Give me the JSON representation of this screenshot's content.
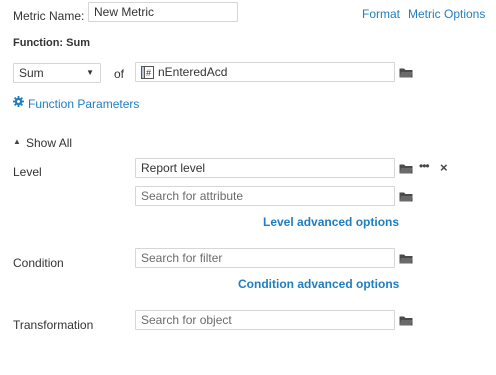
{
  "header": {
    "metric_name_label": "Metric Name:",
    "metric_name_value": "New Metric",
    "format_link": "Format",
    "metric_options_link": "Metric Options"
  },
  "function": {
    "title": "Function: Sum",
    "selected": "Sum",
    "of_label": "of",
    "object_value": "nEnteredAcd",
    "parameters_link": "Function Parameters"
  },
  "show_all": {
    "label": "Show All"
  },
  "level": {
    "label": "Level",
    "value": "Report level",
    "search_placeholder": "Search for attribute",
    "advanced_link": "Level advanced options"
  },
  "condition": {
    "label": "Condition",
    "search_placeholder": "Search for filter",
    "advanced_link": "Condition advanced options"
  },
  "transformation": {
    "label": "Transformation",
    "search_placeholder": "Search for object"
  },
  "colors": {
    "link": "#1f7ec0",
    "border": "#d6d6d6",
    "text": "#333333"
  }
}
